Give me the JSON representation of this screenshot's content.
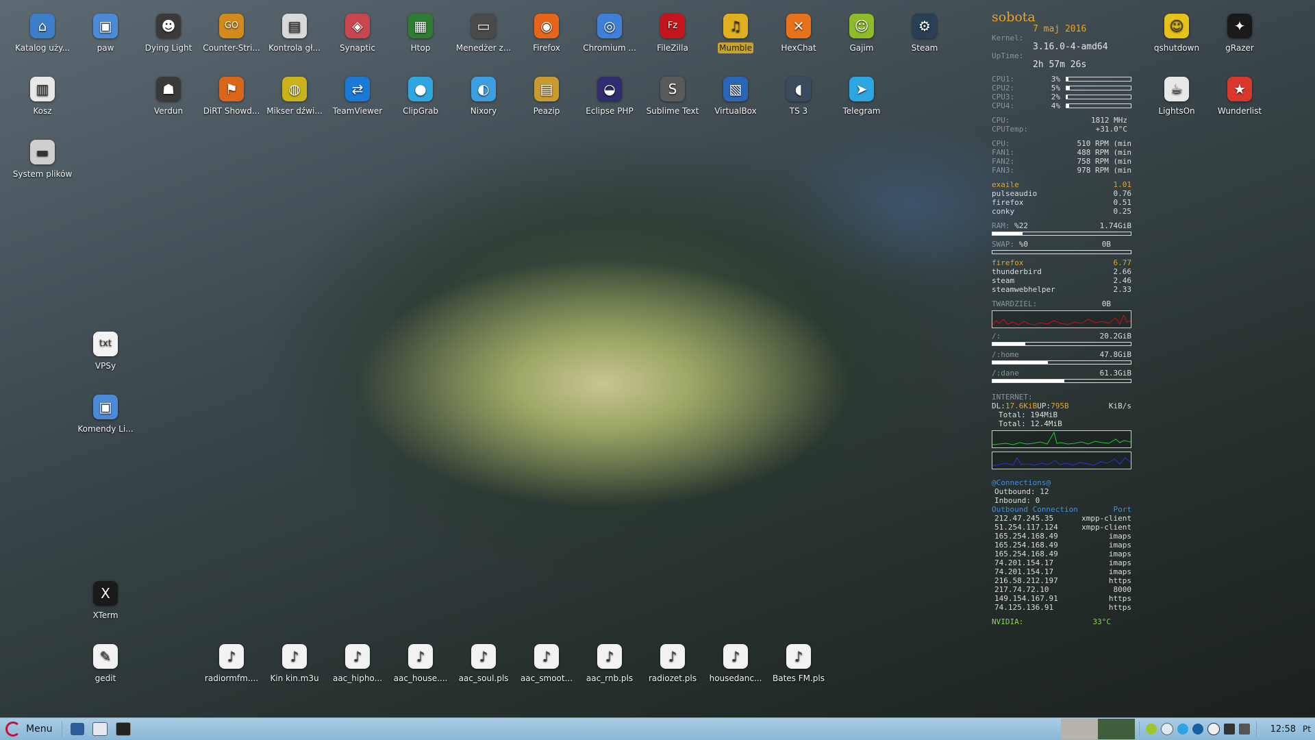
{
  "desktop_icons": [
    {
      "label": "Katalog uży...",
      "icon": "folder-home-icon",
      "color": "#3d7ec9",
      "glyph": "⌂"
    },
    {
      "label": "paw",
      "icon": "folder-icon",
      "color": "#4a8ad6",
      "glyph": "▣"
    },
    {
      "label": "Dying Light",
      "icon": "dying-light-icon",
      "color": "#3a3a3a",
      "glyph": "☻"
    },
    {
      "label": "Counter-Stri...",
      "icon": "csgo-icon",
      "color": "#d18a1c",
      "glyph": "GO"
    },
    {
      "label": "Kontrola gł...",
      "icon": "volume-control-icon",
      "color": "#d9d9d9",
      "glyph": "▤"
    },
    {
      "label": "Synaptic",
      "icon": "synaptic-icon",
      "color": "#c9464e",
      "glyph": "◈"
    },
    {
      "label": "Htop",
      "icon": "htop-icon",
      "color": "#2e7d32",
      "glyph": "▦"
    },
    {
      "label": "Menedżer z...",
      "icon": "task-manager-icon",
      "color": "#4a4a4a",
      "glyph": "▭"
    },
    {
      "label": "Firefox",
      "icon": "firefox-icon",
      "color": "#e8641b",
      "glyph": "◉"
    },
    {
      "label": "Chromium ...",
      "icon": "chromium-icon",
      "color": "#3f7fd6",
      "glyph": "◎"
    },
    {
      "label": "FileZilla",
      "icon": "filezilla-icon",
      "color": "#c3161c",
      "glyph": "Fz"
    },
    {
      "label": "Mumble",
      "icon": "mumble-icon",
      "color": "#e0b020",
      "glyph": "♫"
    },
    {
      "label": "HexChat",
      "icon": "hexchat-icon",
      "color": "#e8721c",
      "glyph": "✕"
    },
    {
      "label": "Gajim",
      "icon": "gajim-icon",
      "color": "#8dbb2a",
      "glyph": "☺"
    },
    {
      "label": "Steam",
      "icon": "steam-icon",
      "color": "#2a3f55",
      "glyph": "⚙"
    },
    {
      "label": "Kosz",
      "icon": "trash-icon",
      "color": "#e8e8e8",
      "glyph": "▥"
    },
    {
      "label": "Verdun",
      "icon": "verdun-icon",
      "color": "#3a3a3a",
      "glyph": "☗"
    },
    {
      "label": "DiRT Showd...",
      "icon": "dirt-showdown-icon",
      "color": "#d9661a",
      "glyph": "⚑"
    },
    {
      "label": "Mikser dźwi...",
      "icon": "sound-mixer-icon",
      "color": "#c9b21a",
      "glyph": "◍"
    },
    {
      "label": "TeamViewer",
      "icon": "teamviewer-icon",
      "color": "#1a78d6",
      "glyph": "⇄"
    },
    {
      "label": "ClipGrab",
      "icon": "clipgrab-icon",
      "color": "#2fa6dd",
      "glyph": "●"
    },
    {
      "label": "Nixory",
      "icon": "nixory-icon",
      "color": "#3c9de0",
      "glyph": "◐"
    },
    {
      "label": "Peazip",
      "icon": "peazip-icon",
      "color": "#c99a2e",
      "glyph": "▤"
    },
    {
      "label": "Eclipse PHP",
      "icon": "eclipse-icon",
      "color": "#2f2d6e",
      "glyph": "◒"
    },
    {
      "label": "Sublime Text",
      "icon": "sublime-text-icon",
      "color": "#5a5a5a",
      "glyph": "S"
    },
    {
      "label": "VirtualBox",
      "icon": "virtualbox-icon",
      "color": "#2a66b8",
      "glyph": "▧"
    },
    {
      "label": "TS 3",
      "icon": "teamspeak-icon",
      "color": "#3b4a5c",
      "glyph": "◖"
    },
    {
      "label": "Telegram",
      "icon": "telegram-icon",
      "color": "#2ca5e0",
      "glyph": "➤"
    },
    {
      "label": "System plików",
      "icon": "drive-icon",
      "color": "#cfcfcf",
      "glyph": "▬"
    },
    {
      "label": "VPSy",
      "icon": "text-file-icon",
      "color": "#f2f2f2",
      "glyph": "txt"
    },
    {
      "label": "Komendy Li...",
      "icon": "folder-icon",
      "color": "#4a8ad6",
      "glyph": "▣"
    },
    {
      "label": "XTerm",
      "icon": "xterm-icon",
      "color": "#1a1a1a",
      "glyph": "X"
    },
    {
      "label": "gedit",
      "icon": "gedit-icon",
      "color": "#f2f2f2",
      "glyph": "✎"
    },
    {
      "label": "radiormfm....",
      "icon": "audio-file-icon",
      "color": "#f2f2f2",
      "glyph": "♪"
    },
    {
      "label": "Kin kin.m3u",
      "icon": "audio-file-icon",
      "color": "#f2f2f2",
      "glyph": "♪"
    },
    {
      "label": "aac_hipho...",
      "icon": "audio-file-icon",
      "color": "#f2f2f2",
      "glyph": "♪"
    },
    {
      "label": "aac_house....",
      "icon": "audio-file-icon",
      "color": "#f2f2f2",
      "glyph": "♪"
    },
    {
      "label": "aac_soul.pls",
      "icon": "audio-file-icon",
      "color": "#f2f2f2",
      "glyph": "♪"
    },
    {
      "label": "aac_smoot...",
      "icon": "audio-file-icon",
      "color": "#f2f2f2",
      "glyph": "♪"
    },
    {
      "label": "aac_rnb.pls",
      "icon": "audio-file-icon",
      "color": "#f2f2f2",
      "glyph": "♪"
    },
    {
      "label": "radiozet.pls",
      "icon": "audio-file-icon",
      "color": "#f2f2f2",
      "glyph": "♪"
    },
    {
      "label": "housedanc...",
      "icon": "audio-file-icon",
      "color": "#f2f2f2",
      "glyph": "♪"
    },
    {
      "label": "Bates FM.pls",
      "icon": "audio-file-icon",
      "color": "#f2f2f2",
      "glyph": "♪"
    },
    {
      "label": "qshutdown",
      "icon": "qshutdown-icon",
      "color": "#e6c21a",
      "glyph": "☺"
    },
    {
      "label": "gRazer",
      "icon": "razer-icon",
      "color": "#1a1a1a",
      "glyph": "✦"
    },
    {
      "label": "LightsOn",
      "icon": "lightson-icon",
      "color": "#e8e8e8",
      "glyph": "☕"
    },
    {
      "label": "Wunderlist",
      "icon": "wunderlist-icon",
      "color": "#d9372e",
      "glyph": "★"
    }
  ],
  "conky": {
    "day": "sobota",
    "date": "7 maj 2016",
    "kernel_label": "Kernel:",
    "kernel": "3.16.0-4-amd64",
    "uptime_label": "UpTime:",
    "uptime": "2h 57m 26s",
    "cpus": [
      {
        "name": "CPU1:",
        "pct": "3%",
        "level": 0.03
      },
      {
        "name": "CPU2:",
        "pct": "5%",
        "level": 0.05
      },
      {
        "name": "CPU3:",
        "pct": "2%",
        "level": 0.02
      },
      {
        "name": "CPU4:",
        "pct": "4%",
        "level": 0.04
      }
    ],
    "freq_label": "CPU:",
    "freq": "1812 MHz",
    "temp_label": "CPUTemp:",
    "temp": "+31.0°C",
    "fans": [
      {
        "name": "CPU:",
        "rpm": "510 RPM",
        "min": "(min"
      },
      {
        "name": "FAN1:",
        "rpm": "488 RPM",
        "min": "(min"
      },
      {
        "name": "FAN2:",
        "rpm": "758 RPM",
        "min": "(min"
      },
      {
        "name": "FAN3:",
        "rpm": "978 RPM",
        "min": "(min"
      }
    ],
    "top_cpu": [
      {
        "name": "exaile",
        "value": "1.01"
      },
      {
        "name": "pulseaudio",
        "value": "0.76"
      },
      {
        "name": "firefox",
        "value": "0.51"
      },
      {
        "name": "conky",
        "value": "0.25"
      }
    ],
    "ram_label": "RAM:",
    "ram_pct": "%22",
    "ram_size": "1.74GiB",
    "ram_level": 0.22,
    "swap_label": "SWAP:",
    "swap_pct": "%0",
    "swap_size": "0B",
    "swap_level": 0.0,
    "top_mem": [
      {
        "name": "firefox",
        "value": "6.77"
      },
      {
        "name": "thunderbird",
        "value": "2.66"
      },
      {
        "name": "steam",
        "value": "2.46"
      },
      {
        "name": "steamwebhelper",
        "value": "2.33"
      }
    ],
    "disk_label": "TWARDZIEL:",
    "disk_io": "0B",
    "mounts": [
      {
        "name": "/:",
        "size": "20.2GiB",
        "level": 0.24
      },
      {
        "name": "/:home",
        "size": "47.8GiB",
        "level": 0.4
      },
      {
        "name": "/:dane",
        "size": "61.3GiB",
        "level": 0.52
      }
    ],
    "internet_label": "INTERNET:",
    "dl_label": "DL:",
    "dl_value": "17.6KiB",
    "up_label": "UP:",
    "up_value": "795B",
    "unit": "KiB/s",
    "total_dl": "Total: 194MiB",
    "total_up": "Total: 12.4MiB",
    "connections_title": "@Connections@",
    "outbound": "Outbound: 12",
    "inbound": "Inbound: 0",
    "conn_header_left": "Outbound Connection",
    "conn_header_right": "Port",
    "connections": [
      {
        "ip": "212.47.245.35",
        "port": "xmpp-client"
      },
      {
        "ip": "51.254.117.124",
        "port": "xmpp-client"
      },
      {
        "ip": "165.254.168.49",
        "port": "imaps"
      },
      {
        "ip": "165.254.168.49",
        "port": "imaps"
      },
      {
        "ip": "165.254.168.49",
        "port": "imaps"
      },
      {
        "ip": "74.201.154.17",
        "port": "imaps"
      },
      {
        "ip": "74.201.154.17",
        "port": "imaps"
      },
      {
        "ip": "216.58.212.197",
        "port": "https"
      },
      {
        "ip": "217.74.72.10",
        "port": "8000"
      },
      {
        "ip": "149.154.167.91",
        "port": "https"
      },
      {
        "ip": "74.125.136.91",
        "port": "https"
      }
    ],
    "nvidia_label": "NVIDIA:",
    "nvidia_temp": "33°C"
  },
  "taskbar": {
    "menu_label": "Menu",
    "clock": "12:58",
    "day_abbr": "Pt"
  },
  "colors": {
    "accent": "#e6a42a",
    "link": "#3b8ee6",
    "taskbar": "#9cc3e0"
  }
}
